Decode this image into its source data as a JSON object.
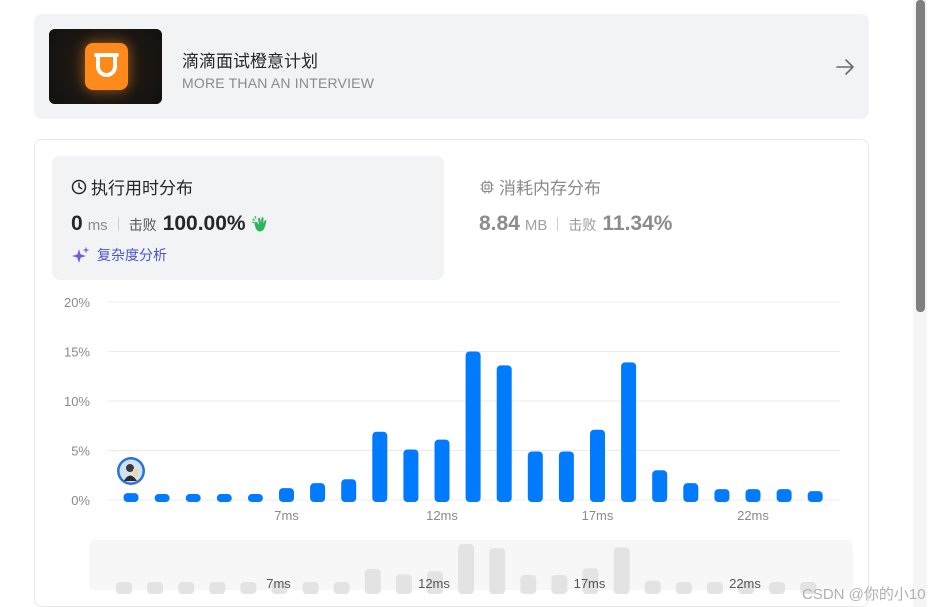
{
  "promo": {
    "title": "滴滴面试橙意计划",
    "subtitle": "MORE THAN AN INTERVIEW",
    "thumb_icon": "didi-logo-icon",
    "arrow_icon": "arrow-right-icon"
  },
  "runtime": {
    "heading": "执行用时分布",
    "value": "0",
    "unit": "ms",
    "beat_label": "击败",
    "beat_value": "100.00%",
    "analysis_label": "复杂度分析",
    "accent": "#4a55d6"
  },
  "memory": {
    "heading": "消耗内存分布",
    "value": "8.84",
    "unit": "MB",
    "beat_label": "击败",
    "beat_value": "11.34%"
  },
  "chart_data": {
    "type": "bar",
    "ylim": [
      0,
      20
    ],
    "yticks": [
      "0%",
      "5%",
      "10%",
      "15%",
      "20%"
    ],
    "ytick_values": [
      0,
      5,
      10,
      15,
      20
    ],
    "xtick_labels": [
      "7ms",
      "12ms",
      "17ms",
      "22ms"
    ],
    "xtick_index": [
      5,
      10,
      15,
      20
    ],
    "x": [
      1,
      2,
      3,
      4,
      5,
      6,
      7,
      8,
      9,
      10,
      11,
      12,
      13,
      14,
      15,
      16,
      17,
      18,
      19,
      20,
      21,
      22,
      23,
      24
    ],
    "values": [
      0.7,
      0.6,
      0.6,
      0.6,
      0.6,
      1.2,
      1.7,
      2.1,
      6.9,
      5.1,
      6.1,
      15.0,
      13.6,
      4.9,
      4.9,
      7.1,
      13.9,
      3.0,
      1.7,
      1.1,
      1.1,
      1.1,
      0.9
    ],
    "bar_color": "#007aff",
    "grid": true,
    "highlight_index": 0,
    "mini_xtick_labels": [
      "7ms",
      "12ms",
      "17ms",
      "22ms"
    ]
  },
  "watermark": "CSDN @你的小10"
}
